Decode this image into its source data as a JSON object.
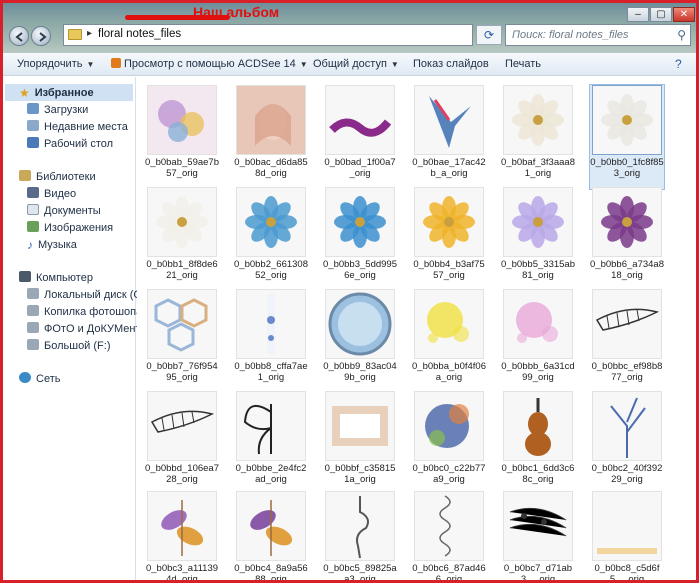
{
  "window": {
    "address_crumb": "floral notes_files",
    "album_label": "Наш альбом",
    "search_placeholder": "Поиск: floral notes_files",
    "min": "–",
    "max": "▢",
    "close": "✕"
  },
  "toolbar": {
    "organize": "Упорядочить",
    "acdsee": "Просмотр с помощью ACDSee 14",
    "share": "Общий доступ",
    "slideshow": "Показ слайдов",
    "print": "Печать"
  },
  "sidebar": {
    "favorites": "Избранное",
    "downloads": "Загрузки",
    "recent": "Недавние места",
    "desktop": "Рабочий стол",
    "libraries": "Библиотеки",
    "video": "Видео",
    "documents": "Документы",
    "images": "Изображения",
    "music": "Музыка",
    "computer": "Компьютер",
    "drive_c": "Локальный диск (C:)",
    "photoshop": "Копилка фотошопа",
    "photos": "ФОтО и ДоКУМенты",
    "drive_f": "Большой (F:)",
    "network": "Сеть"
  },
  "files": [
    {
      "name": "0_b0bab_59ae7b57_orig",
      "kind": "collage",
      "color": "#c9a7d8"
    },
    {
      "name": "0_b0bac_d6da858d_orig",
      "kind": "portrait",
      "color": "#d9a38c"
    },
    {
      "name": "0_b0bad_1f00a7_orig",
      "kind": "ribbon",
      "color": "#8a2a8a"
    },
    {
      "name": "0_b0bae_17ac42b_a_orig",
      "kind": "bird",
      "color": "#3a6fb0"
    },
    {
      "name": "0_b0baf_3f3aaa81_orig",
      "kind": "flower",
      "color": "#ece6d6"
    },
    {
      "name": "0_b0bb0_1fc8f853_orig",
      "kind": "flower",
      "color": "#eae8e2"
    },
    {
      "name": "0_b0bb1_8f8de621_orig",
      "kind": "flower",
      "color": "#f2f0ea"
    },
    {
      "name": "0_b0bb2_66130852_orig",
      "kind": "flower",
      "color": "#4a9ad0"
    },
    {
      "name": "0_b0bb3_5dd9956e_orig",
      "kind": "flower",
      "color": "#3b8fcf"
    },
    {
      "name": "0_b0bb4_b3af7557_orig",
      "kind": "flower",
      "color": "#f0b42a"
    },
    {
      "name": "0_b0bb5_3315ab81_orig",
      "kind": "flower",
      "color": "#b9a8e8"
    },
    {
      "name": "0_b0bb6_a734a818_orig",
      "kind": "flower",
      "color": "#7a3a8a"
    },
    {
      "name": "0_b0bb7_76f95495_orig",
      "kind": "hex",
      "color": "#9ab6d8"
    },
    {
      "name": "0_b0bb8_cffa7ae1_orig",
      "kind": "strip",
      "color": "#6a8ad0"
    },
    {
      "name": "0_b0bb9_83ac049b_orig",
      "kind": "circle",
      "color": "#9cc0e0"
    },
    {
      "name": "0_b0bba_b0f4f06a_orig",
      "kind": "splash",
      "color": "#f0e040"
    },
    {
      "name": "0_b0bbb_6a31cd99_orig",
      "kind": "splash",
      "color": "#e8a8d8"
    },
    {
      "name": "0_b0bbc_ef98b877_orig",
      "kind": "wing",
      "color": "#333333"
    },
    {
      "name": "0_b0bbd_106ea728_orig",
      "kind": "wing",
      "color": "#333333"
    },
    {
      "name": "0_b0bbe_2e4fc2ad_orig",
      "kind": "butterfly",
      "color": "#222222"
    },
    {
      "name": "0_b0bbf_c358151a_orig",
      "kind": "wash",
      "color": "#d8a070"
    },
    {
      "name": "0_b0bc0_c22b77a9_orig",
      "kind": "face",
      "color": "#3a5aa0"
    },
    {
      "name": "0_b0bc1_6dd3c68c_orig",
      "kind": "violin",
      "color": "#b06020"
    },
    {
      "name": "0_b0bc2_40f39229_orig",
      "kind": "branch",
      "color": "#4a6ab0"
    },
    {
      "name": "0_b0bc3_a111394d_orig",
      "kind": "leaves",
      "color": "#a070c0"
    },
    {
      "name": "0_b0bc4_8a9a5688_orig",
      "kind": "leaves",
      "color": "#8a5aa8"
    },
    {
      "name": "0_b0bc5_89825aa3_orig",
      "kind": "spiral",
      "color": "#555555"
    },
    {
      "name": "0_b0bc6_87ad466_orig",
      "kind": "scribble",
      "color": "#666666"
    },
    {
      "name": "0_b0bc7_d71ab3..._orig",
      "kind": "notes",
      "color": "#333333"
    },
    {
      "name": "0_b0bc8_c5d6f5..._orig",
      "kind": "dots",
      "color": "#f0c060"
    }
  ]
}
